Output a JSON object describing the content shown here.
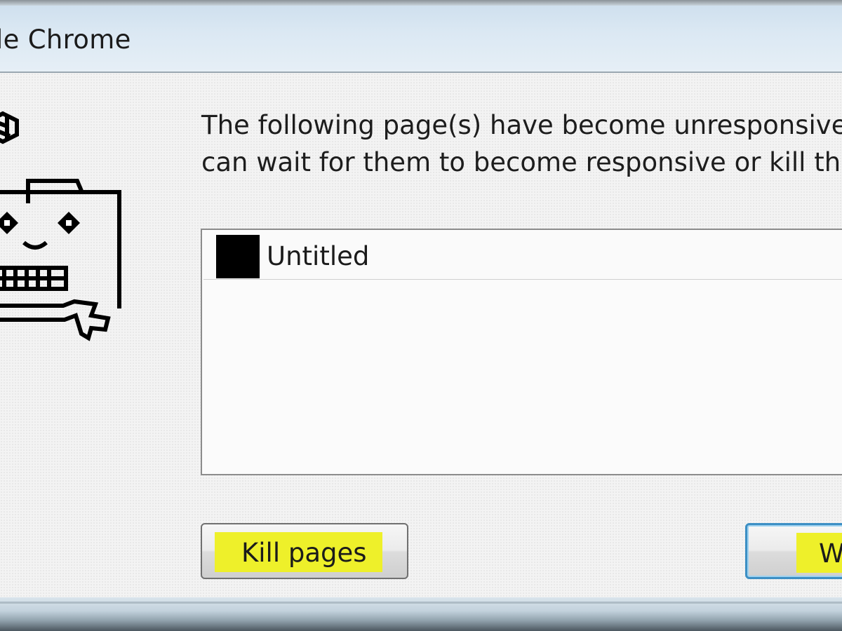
{
  "window": {
    "title": "le Chrome"
  },
  "dialog": {
    "message_line1": "The following page(s) have become unresponsive",
    "message_line2": "can wait for them to become responsive or kill th",
    "pages": [
      {
        "label": "Untitled"
      }
    ],
    "buttons": {
      "kill_label": "Kill pages",
      "wait_label": "W"
    }
  },
  "colors": {
    "title_bar": "#dbe8f3",
    "highlight": "#eef02a",
    "default_button_border": "#3c8fc4"
  },
  "icons": {
    "mascot": "sad-folder-icon",
    "favicon": "page-favicon-icon"
  }
}
